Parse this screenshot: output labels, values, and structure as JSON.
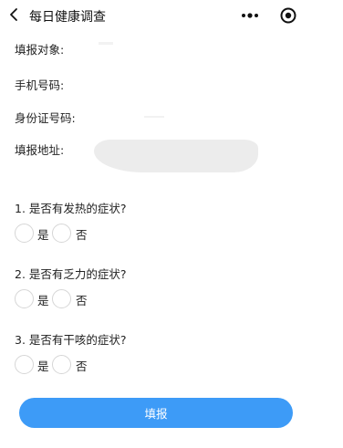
{
  "header": {
    "title": "每日健康调查",
    "back_icon": "chevron-left-icon",
    "more_icon": "more-dots-icon",
    "record_icon": "record-circle-icon"
  },
  "info_fields": [
    {
      "label": "填报对象:"
    },
    {
      "label": "手机号码:"
    },
    {
      "label": "身份证号码:"
    },
    {
      "label": "填报地址:"
    }
  ],
  "questions": [
    {
      "title": "1. 是否有发热的症状?",
      "options": [
        "是",
        "否"
      ]
    },
    {
      "title": "2. 是否有乏力的症状?",
      "options": [
        "是",
        "否"
      ]
    },
    {
      "title": "3. 是否有干咳的症状?",
      "options": [
        "是",
        "否"
      ]
    }
  ],
  "submit": {
    "label": "填报"
  },
  "colors": {
    "accent": "#3d9bf7",
    "text": "#222222",
    "radio_border": "#d6d6d6"
  }
}
